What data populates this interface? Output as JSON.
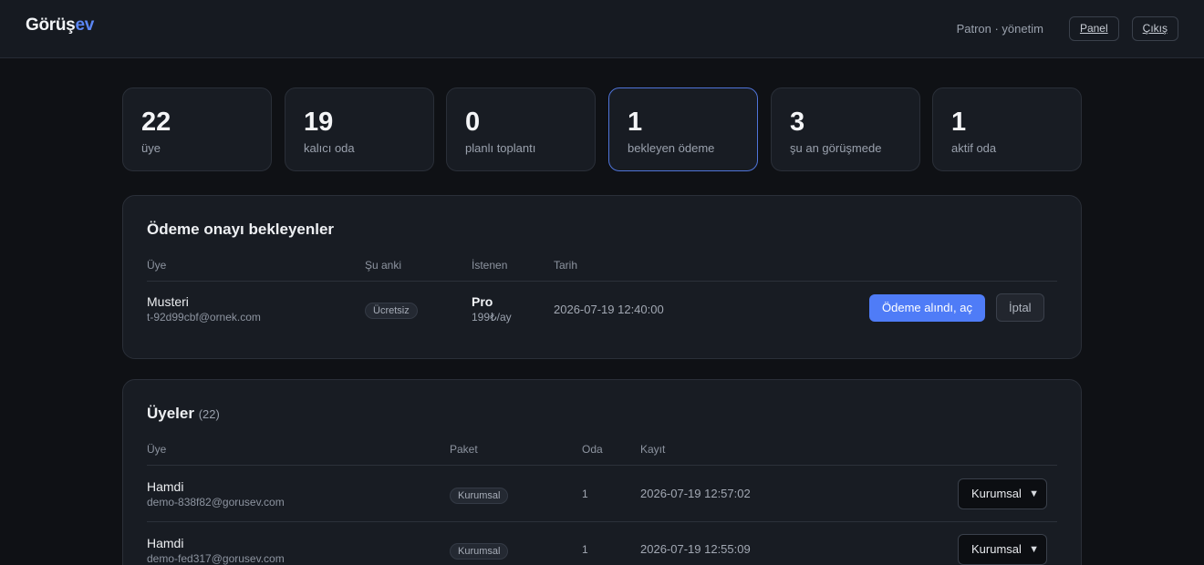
{
  "header": {
    "logo_main": "Görüş",
    "logo_accent": "ev",
    "role": "Patron · yönetim",
    "panel_label": "Panel",
    "logout_label": "Çıkış"
  },
  "stats": [
    {
      "value": "22",
      "label": "üye"
    },
    {
      "value": "19",
      "label": "kalıcı oda"
    },
    {
      "value": "0",
      "label": "planlı toplantı"
    },
    {
      "value": "1",
      "label": "bekleyen ödeme"
    },
    {
      "value": "3",
      "label": "şu an görüşmede"
    },
    {
      "value": "1",
      "label": "aktif oda"
    }
  ],
  "pending": {
    "title": "Ödeme onayı bekleyenler",
    "columns": [
      "Üye",
      "Şu anki",
      "İstenen",
      "Tarih"
    ],
    "rows": [
      {
        "name": "Musteri",
        "email": "t-92d99cbf@ornek.com",
        "current": "Ücretsiz",
        "requested_plan": "Pro",
        "requested_price": "199₺/ay",
        "date": "2026-07-19 12:40:00",
        "approve_label": "Ödeme alındı, aç",
        "cancel_label": "İptal"
      }
    ]
  },
  "members": {
    "title": "Üyeler",
    "count": "(22)",
    "columns": [
      "Üye",
      "Paket",
      "Oda",
      "Kayıt"
    ],
    "rows": [
      {
        "name": "Hamdi",
        "email": "demo-838f82@gorusev.com",
        "plan": "Kurumsal",
        "rooms": "1",
        "registered": "2026-07-19 12:57:02",
        "select_value": "Kurumsal"
      },
      {
        "name": "Hamdi",
        "email": "demo-fed317@gorusev.com",
        "plan": "Kurumsal",
        "rooms": "1",
        "registered": "2026-07-19 12:55:09",
        "select_value": "Kurumsal"
      }
    ]
  }
}
